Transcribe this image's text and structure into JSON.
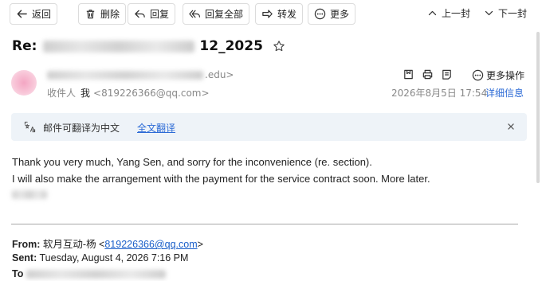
{
  "toolbar": {
    "back_label": "返回",
    "delete_label": "删除",
    "reply_label": "回复",
    "reply_all_label": "回复全部",
    "forward_label": "转发",
    "more_label": "更多",
    "prev_label": "上一封",
    "next_label": "下一封"
  },
  "subject": {
    "prefix": "Re:",
    "suffix": "12_2025"
  },
  "sender": {
    "email_suffix": ".edu>"
  },
  "recipient": {
    "label": "收件人",
    "name": "我",
    "address": "<819226366@qq.com>"
  },
  "header_actions": {
    "more_ops_label": "更多操作",
    "date": "2026年8月5日 17:54",
    "details_label": "详细信息"
  },
  "translate_bar": {
    "label": "邮件可翻译为中文",
    "link": "全文翻译"
  },
  "message": {
    "line1": "Thank you very much, Yang Sen, and sorry for the inconvenience (re. section).",
    "line2": "I will also make the arrangement with the payment for the service contract soon. More later."
  },
  "quoted": {
    "from_label": "From:",
    "from_name": "软月互动-杨",
    "from_email": "819226366@qq.com",
    "sent_label": "Sent:",
    "sent_value": "Tuesday, August 4, 2026 7:16 PM",
    "to_label": "To"
  },
  "colors": {
    "link": "#2d6bd6",
    "translate_bg": "#eef3f8",
    "muted_text": "#888888"
  },
  "icons": {
    "back": "arrow-left-icon",
    "delete": "trash-icon",
    "reply": "reply-icon",
    "reply_all": "reply-all-icon",
    "forward": "forward-icon",
    "more": "ellipsis-circle-icon",
    "prev": "chevron-up-icon",
    "next": "chevron-down-icon",
    "star": "star-icon",
    "translate": "translate-icon",
    "close": "close-icon"
  }
}
